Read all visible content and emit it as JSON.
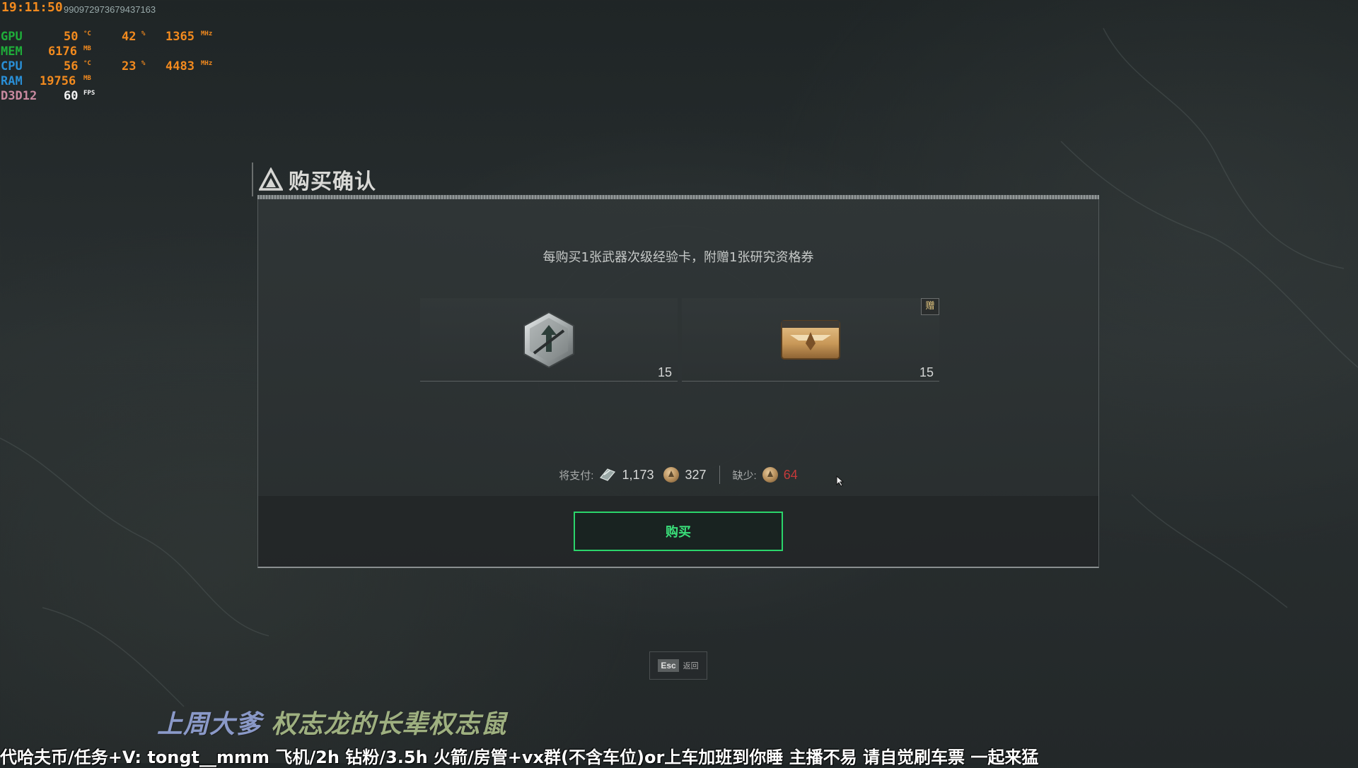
{
  "osd": {
    "time": "19:11:50",
    "session_id": "990972973679437163",
    "rows": [
      {
        "label": "GPU",
        "v1": "50",
        "u1": "°C",
        "v2": "42",
        "u2": "%",
        "v3": "1365",
        "u3": "MHz"
      },
      {
        "label": "MEM",
        "v1": "6176",
        "u1": "MB"
      },
      {
        "label": "CPU",
        "v1": "56",
        "u1": "°C",
        "v2": "23",
        "u2": "%",
        "v3": "4483",
        "u3": "MHz"
      },
      {
        "label": "RAM",
        "v1": "19756",
        "u1": "MB"
      },
      {
        "label": "D3D12",
        "v1": "60",
        "u1": "FPS"
      }
    ]
  },
  "dialog": {
    "title": "购买确认",
    "description": "每购买1张武器次级经验卡，附赠1张研究资格券",
    "items": [
      {
        "name": "武器次级经验卡",
        "icon": "weapon-exp-card-icon",
        "count": "15",
        "gift": false
      },
      {
        "name": "研究资格券",
        "icon": "research-ticket-icon",
        "count": "15",
        "gift": true,
        "gift_label": "赠"
      }
    ],
    "payment": {
      "pay_label": "将支付:",
      "cost_diamond": "1,173",
      "cost_coin": "327",
      "short_label": "缺少:",
      "short_coin": "64"
    },
    "buy_label": "购买"
  },
  "footer": {
    "esc_key": "Esc",
    "esc_label": "返回"
  },
  "stream": {
    "name_part1": "上周大爹",
    "name_part2": "权志龙的长辈权志鼠",
    "ticker": "代哈夫币/任务+V: tongt__mmm  飞机/2h  钻粉/3.5h  火箭/房管+vx群(不含车位)or上车加班到你睡  主播不易 请自觉刷车票 一起来猛"
  },
  "colors": {
    "accent_green": "#2bd56b",
    "short_red": "#c43a3a",
    "osd_orange": "#f28a1e"
  }
}
